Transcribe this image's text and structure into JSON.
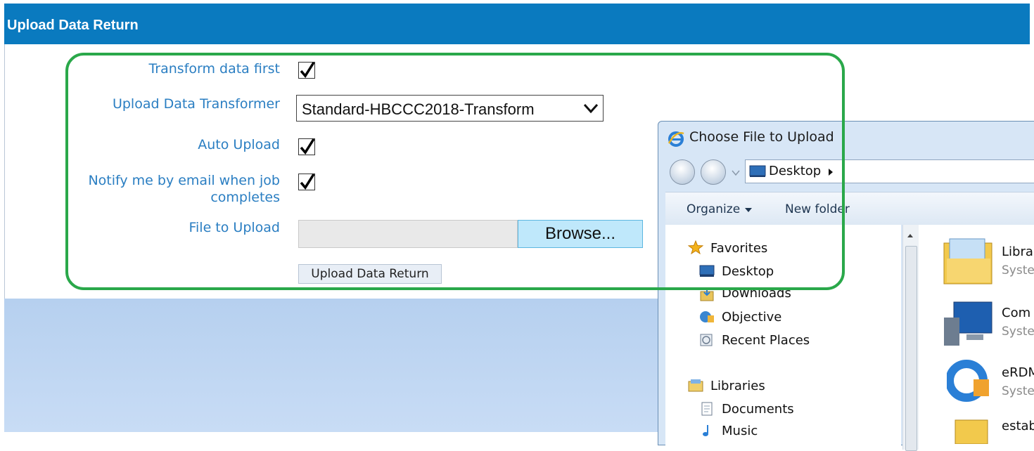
{
  "header": {
    "title": "Upload Data Return"
  },
  "form": {
    "transform_label": "Transform data first",
    "transformer_label": "Upload Data Transformer",
    "transformer_value": "Standard-HBCCC2018-Transform",
    "auto_upload_label": "Auto Upload",
    "notify_label_1": "Notify me by email when job",
    "notify_label_2": "completes",
    "file_label": "File to Upload",
    "browse_label": "Browse...",
    "upload_button": "Upload Data Return",
    "transform_checked": true,
    "auto_upload_checked": true,
    "notify_checked": true
  },
  "dialog": {
    "title": "Choose File to Upload",
    "address": "Desktop",
    "toolbar": {
      "organize": "Organize",
      "new_folder": "New folder"
    },
    "nav": {
      "favorites": "Favorites",
      "desktop": "Desktop",
      "downloads": "Downloads",
      "objective": "Objective",
      "recent": "Recent Places",
      "libraries": "Libraries",
      "documents": "Documents",
      "music": "Music"
    },
    "files": [
      {
        "name": "Libra",
        "sub": "Syste"
      },
      {
        "name": "Com",
        "sub": "Syste"
      },
      {
        "name": "eRDM",
        "sub": "Syste"
      },
      {
        "name": "estab",
        "sub": ""
      }
    ]
  },
  "colors": {
    "header": "#0a7abf",
    "label": "#2a7ec2",
    "highlight": "#2aa84a",
    "browse": "#bfe8fb"
  }
}
